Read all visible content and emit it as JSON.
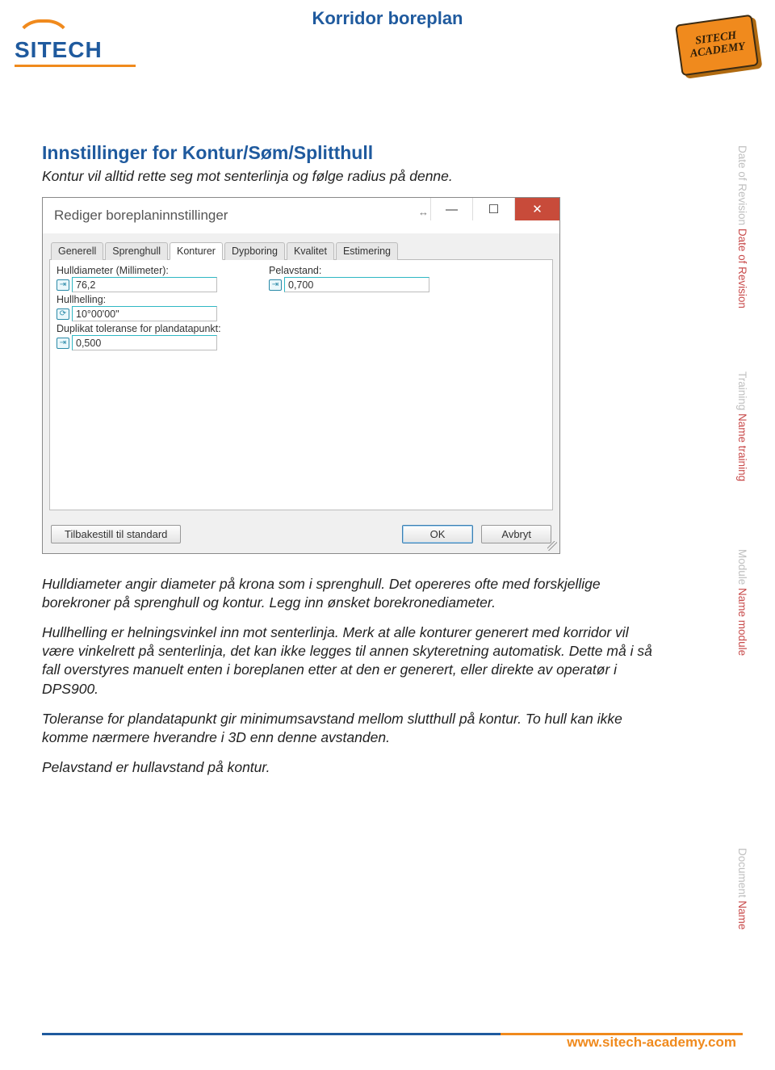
{
  "header": {
    "doc_title": "Korridor boreplan",
    "brand_name": "SITECH",
    "academy_line1": "SITECH",
    "academy_line2": "ACADEMY"
  },
  "section": {
    "title": "Innstillinger for Kontur/Søm/Splitthull",
    "intro": "Kontur vil alltid rette seg mot senterlinja og følge radius på denne.",
    "para1": "Hulldiameter angir diameter på krona som i sprenghull. Det opereres ofte med forskjellige borekroner på sprenghull og kontur. Legg inn ønsket borekronediameter.",
    "para2": "Hullhelling er helningsvinkel inn mot senterlinja. Merk at alle konturer generert med korridor vil være vinkelrett på senterlinja, det kan ikke legges til annen skyteretning automatisk. Dette må i så fall overstyres manuelt enten i boreplanen etter at den er generert, eller direkte av operatør i DPS900.",
    "para3": "Toleranse for plandatapunkt gir minimumsavstand mellom slutthull på kontur. To hull kan ikke komme nærmere hverandre i 3D enn denne avstanden.",
    "para4": "Pelavstand er hullavstand på kontur."
  },
  "dialog": {
    "title": "Rediger boreplaninnstillinger",
    "tabs": [
      "Generell",
      "Sprenghull",
      "Konturer",
      "Dypboring",
      "Kvalitet",
      "Estimering"
    ],
    "active_tab_index": 2,
    "fields": {
      "hulldiameter_label": "Hulldiameter (Millimeter):",
      "hulldiameter_value": "76,2",
      "pelavstand_label": "Pelavstand:",
      "pelavstand_value": "0,700",
      "hullhelling_label": "Hullhelling:",
      "hullhelling_value": "10°00'00\"",
      "duplikat_label": "Duplikat toleranse for plandatapunkt:",
      "duplikat_value": "0,500"
    },
    "buttons": {
      "reset": "Tilbakestill til standard",
      "ok": "OK",
      "cancel": "Avbryt"
    }
  },
  "side": {
    "rev_label": "Date of Revision",
    "rev_accent": "Date of Revision",
    "train_label": "Training",
    "train_accent": "Name training",
    "mod_label": "Module",
    "mod_accent": "Name module",
    "doc_label": "Document",
    "doc_accent": "Name"
  },
  "footer": {
    "url": "www.sitech-academy.com"
  }
}
